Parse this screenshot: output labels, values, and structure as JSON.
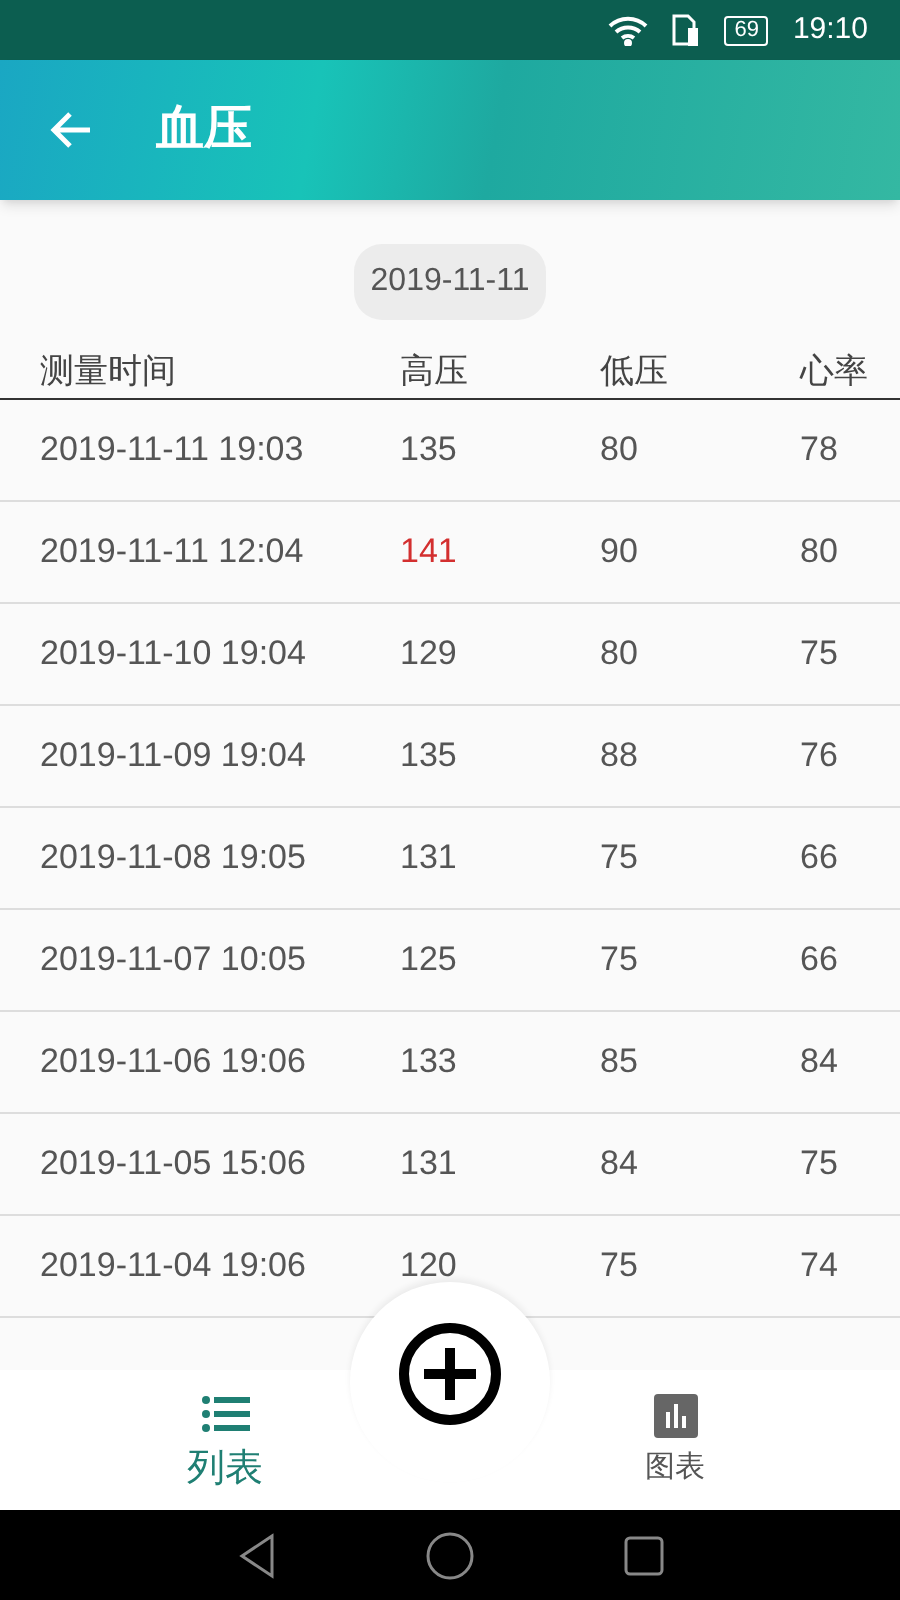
{
  "status_bar": {
    "battery": "69",
    "time": "19:10"
  },
  "header": {
    "title": "血压"
  },
  "date_chip": "2019-11-11",
  "table": {
    "columns": [
      "测量时间",
      "高压",
      "低压",
      "心率"
    ],
    "rows": [
      {
        "time": "2019-11-11 19:03",
        "systolic": "135",
        "diastolic": "80",
        "pulse": "78",
        "alert": false
      },
      {
        "time": "2019-11-11 12:04",
        "systolic": "141",
        "diastolic": "90",
        "pulse": "80",
        "alert": true
      },
      {
        "time": "2019-11-10 19:04",
        "systolic": "129",
        "diastolic": "80",
        "pulse": "75",
        "alert": false
      },
      {
        "time": "2019-11-09 19:04",
        "systolic": "135",
        "diastolic": "88",
        "pulse": "76",
        "alert": false
      },
      {
        "time": "2019-11-08 19:05",
        "systolic": "131",
        "diastolic": "75",
        "pulse": "66",
        "alert": false
      },
      {
        "time": "2019-11-07 10:05",
        "systolic": "125",
        "diastolic": "75",
        "pulse": "66",
        "alert": false
      },
      {
        "time": "2019-11-06 19:06",
        "systolic": "133",
        "diastolic": "85",
        "pulse": "84",
        "alert": false
      },
      {
        "time": "2019-11-05 15:06",
        "systolic": "131",
        "diastolic": "84",
        "pulse": "75",
        "alert": false
      },
      {
        "time": "2019-11-04 19:06",
        "systolic": "120",
        "diastolic": "75",
        "pulse": "74",
        "alert": false
      }
    ]
  },
  "tabs": [
    {
      "label": "列表",
      "kind": "list",
      "selected": true
    },
    {
      "label": "图表",
      "kind": "chart",
      "selected": false
    }
  ]
}
